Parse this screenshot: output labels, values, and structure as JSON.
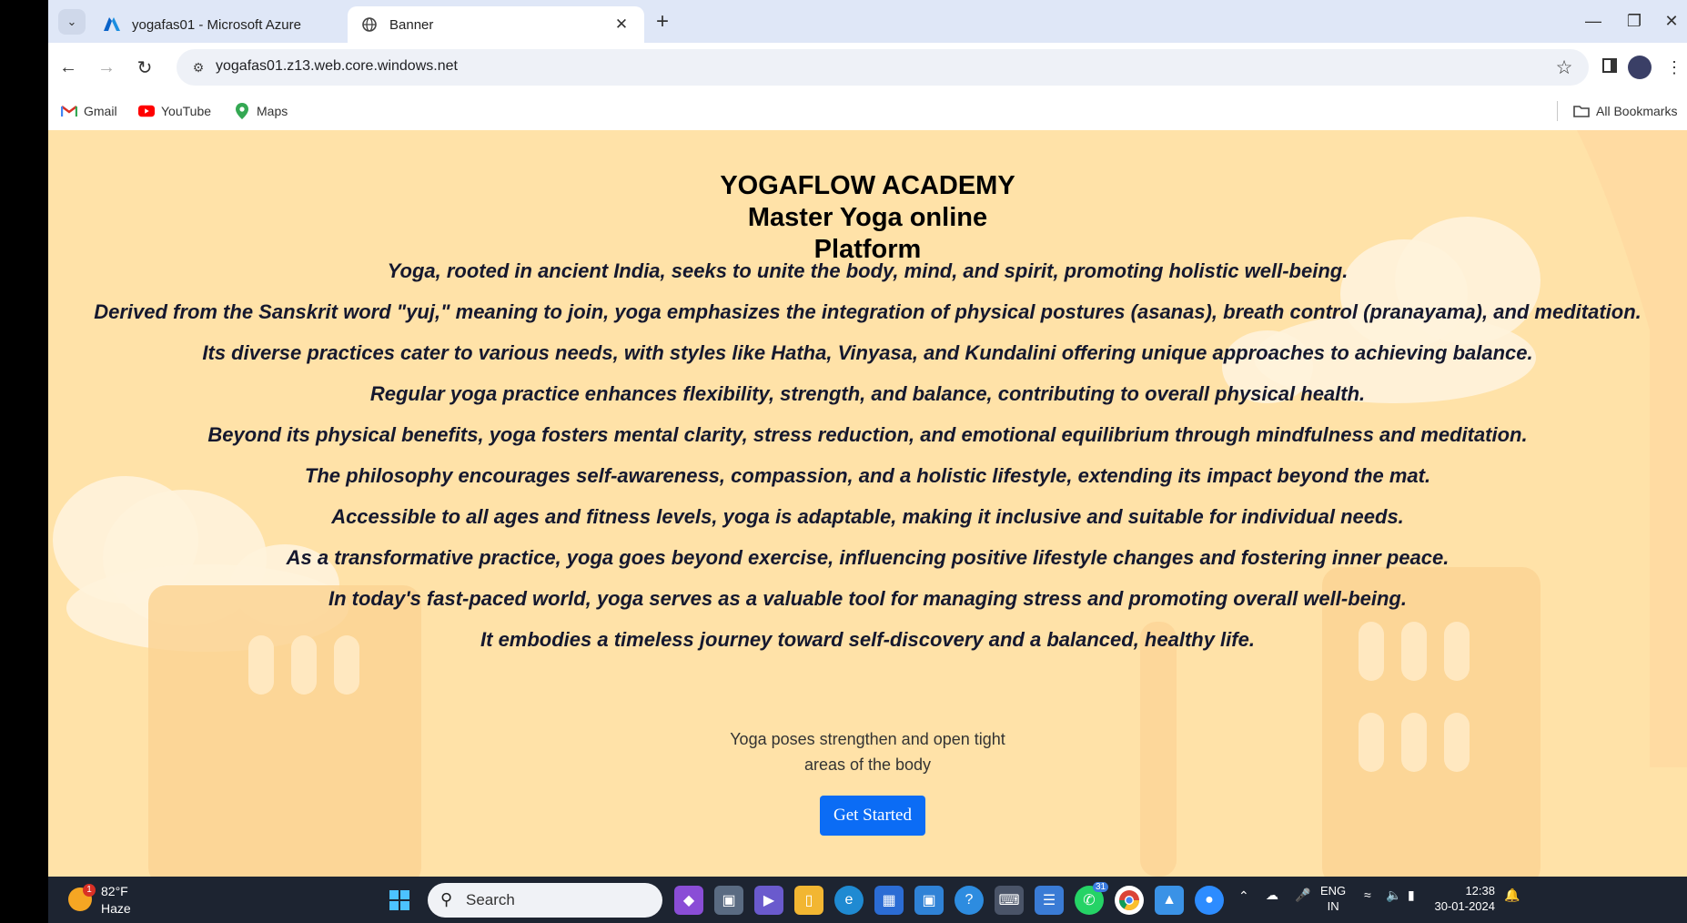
{
  "tabs": [
    {
      "title": "yogafas01 - Microsoft Azure",
      "icon": "azure-icon",
      "active": false
    },
    {
      "title": "Banner",
      "icon": "globe-icon",
      "active": true
    }
  ],
  "toolbar": {
    "url": "yogafas01.z13.web.core.windows.net"
  },
  "bookmarks": [
    {
      "label": "Gmail",
      "icon": "gmail-icon"
    },
    {
      "label": "YouTube",
      "icon": "youtube-icon"
    },
    {
      "label": "Maps",
      "icon": "maps-icon"
    }
  ],
  "all_bookmarks_label": "All Bookmarks",
  "page": {
    "heading_line1": "YOGAFLOW ACADEMY",
    "heading_line2": "Master Yoga online",
    "heading_line3": "Platform",
    "paragraphs": [
      "Yoga, rooted in ancient India, seeks to unite the body, mind, and spirit, promoting holistic well-being.",
      "Derived from the Sanskrit word \"yuj,\" meaning to join, yoga emphasizes the integration of physical postures (asanas), breath control (pranayama), and meditation.",
      "Its diverse practices cater to various needs, with styles like Hatha, Vinyasa, and Kundalini offering unique approaches to achieving balance.",
      "Regular yoga practice enhances flexibility, strength, and balance, contributing to overall physical health.",
      "Beyond its physical benefits, yoga fosters mental clarity, stress reduction, and emotional equilibrium through mindfulness and meditation.",
      "The philosophy encourages self-awareness, compassion, and a holistic lifestyle, extending its impact beyond the mat.",
      "Accessible to all ages and fitness levels, yoga is adaptable, making it inclusive and suitable for individual needs.",
      "As a transformative practice, yoga goes beyond exercise, influencing positive lifestyle changes and fostering inner peace.",
      "In today's fast-paced world, yoga serves as a valuable tool for managing stress and promoting overall well-being.",
      "It embodies a timeless journey toward self-discovery and a balanced, healthy life."
    ],
    "tagline_line1": "Yoga poses strengthen and open tight",
    "tagline_line2": "areas of the body",
    "cta_label": "Get Started"
  },
  "taskbar": {
    "weather_temp": "82°F",
    "weather_cond": "Haze",
    "weather_badge": "1",
    "search_label": "Search",
    "whatsapp_badge": "31",
    "lang_line1": "ENG",
    "lang_line2": "IN",
    "time": "12:38",
    "date": "30-01-2024"
  },
  "colors": {
    "page_bg": "#ffe2a8",
    "heading": "#152d5c",
    "cta_bg": "#0b6cf5",
    "taskbar_bg": "#1d2431",
    "tabstrip_bg": "#dfe7f7"
  }
}
